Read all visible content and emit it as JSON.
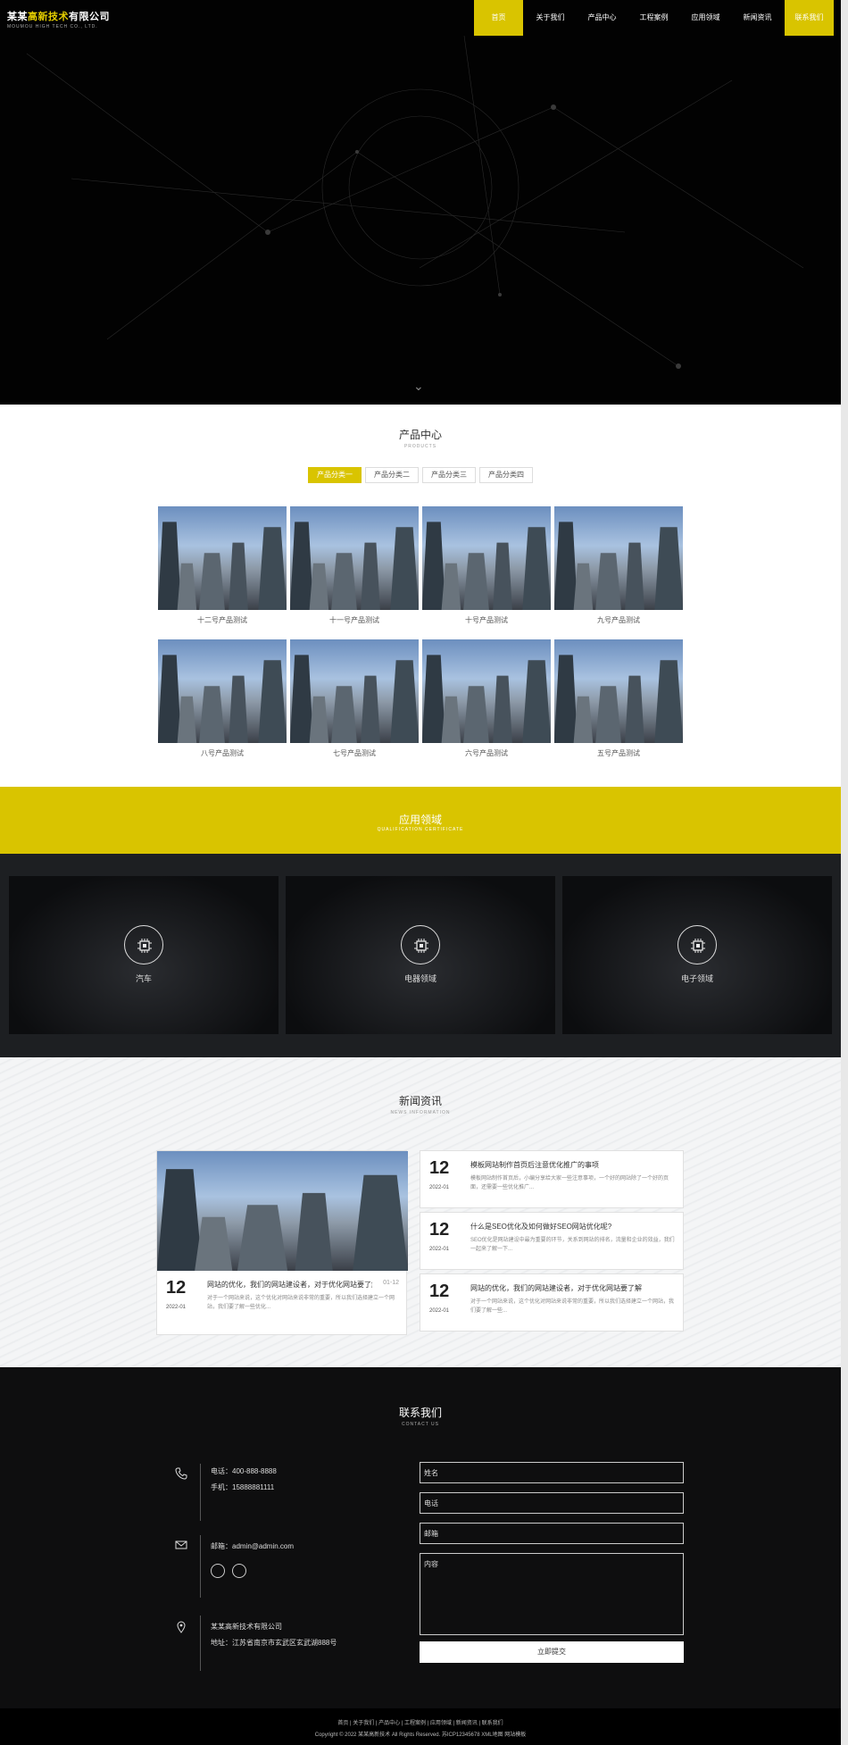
{
  "brand": {
    "name_pre": "某某",
    "name_hl": "高新技术",
    "name_post": "有限公司",
    "name_en": "MOUMOU HIGH TECH CO., LTD."
  },
  "nav": {
    "items": [
      "首页",
      "关于我们",
      "产品中心",
      "工程案例",
      "应用领域",
      "新闻资讯",
      "联系我们"
    ]
  },
  "products": {
    "title": "产品中心",
    "subtitle": "PRODUCTS",
    "tabs": [
      "产品分类一",
      "产品分类二",
      "产品分类三",
      "产品分类四"
    ],
    "items": [
      "十二号产品测试",
      "十一号产品测试",
      "十号产品测试",
      "九号产品测试",
      "八号产品测试",
      "七号产品测试",
      "六号产品测试",
      "五号产品测试"
    ]
  },
  "apply": {
    "title": "应用领域",
    "subtitle": "QUALIFICATION CERTIFICATE",
    "items": [
      "汽车",
      "电器领域",
      "电子领域"
    ]
  },
  "news": {
    "title": "新闻资讯",
    "subtitle": "NEWS INFORMATION",
    "items": [
      {
        "day": "12",
        "ym": "2022-01",
        "title": "网站的优化，我们的网站建设者，对于优化网站要了解",
        "date": "01-12",
        "desc": "对于一个网站来说，这个优化对网站来说非常的重要，所以我们选择建立一个网站，我们要了解一些优化..."
      },
      {
        "day": "12",
        "ym": "2022-01",
        "title": "模板网站制作首页后注意优化推广的事项",
        "date": "",
        "desc": "模板网站制作首页后，小编分享给大家一些注意事项，一个好的网站除了一个好的页面，还需要一些优化推广..."
      },
      {
        "day": "12",
        "ym": "2022-01",
        "title": "什么是SEO优化及如何做好SEO网站优化呢?",
        "date": "",
        "desc": "SEO优化是网站建设中最为重要的环节，关系到网站的排名，流量和企业的效益，我们一起来了解一下..."
      },
      {
        "day": "12",
        "ym": "2022-01",
        "title": "网站的优化，我们的网站建设者，对于优化网站要了解",
        "date": "",
        "desc": "对于一个网站来说，这个优化对网站来说非常的重要，所以我们选择建立一个网站，我们要了解一些..."
      }
    ]
  },
  "contact": {
    "title": "联系我们",
    "subtitle": "CONTACT US",
    "phone": "电话：400-888-8888",
    "mobile": "手机：15888881111",
    "email": "邮箱：admin@admin.com",
    "company": "某某高新技术有限公司",
    "address": "地址：江苏省南京市玄武区玄武湖888号",
    "form": {
      "name": "姓名",
      "phone": "电话",
      "email": "邮箱",
      "content": "内容",
      "submit": "立即提交"
    }
  },
  "footer": {
    "links": "首页  |  关于我们  |  产品中心  |  工程案例  |  应用领域  |  新闻资讯  |  联系我们",
    "copy": "Copyright © 2022 某某高新技术 All Rights Reserved. 苏ICP12345678 XML地图 网站模板"
  }
}
